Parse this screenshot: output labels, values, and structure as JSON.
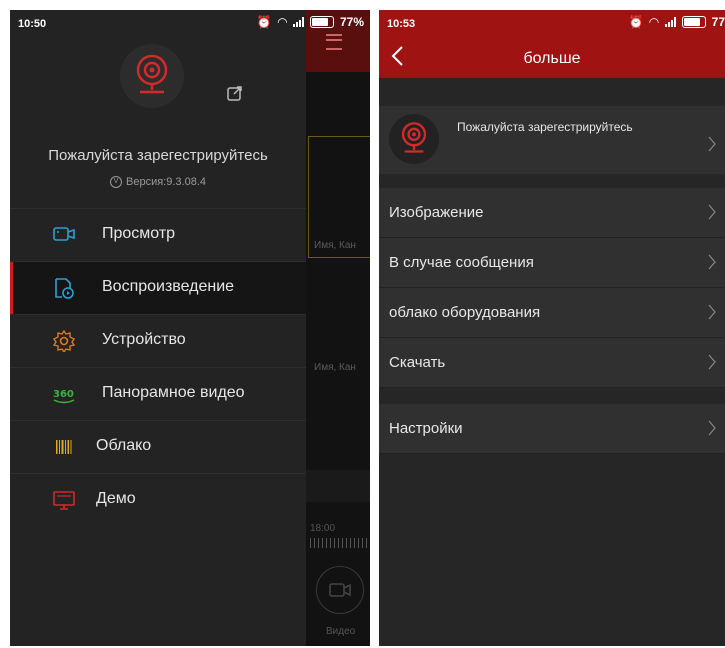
{
  "left_screen": {
    "status": {
      "time": "10:50",
      "battery": "77%"
    },
    "prompt": "Пожалуйста зарегестрируйтесь",
    "version": "Версия:9.3.08.4",
    "menu": [
      {
        "label": "Просмотр",
        "icon": "camera-icon",
        "active": false
      },
      {
        "label": "Воспроизведение",
        "icon": "playback-icon",
        "active": true
      },
      {
        "label": "Устройство",
        "icon": "gear-icon",
        "active": false
      },
      {
        "label": "Панорамное видео",
        "icon": "panorama-360-icon",
        "active": false
      },
      {
        "label": "Облако",
        "icon": "cloud-icon",
        "active": false
      },
      {
        "label": "Демо",
        "icon": "demo-monitor-icon",
        "active": false
      }
    ],
    "behind_labels": {
      "name1": "Имя, Кан",
      "name2": "Имя, Кан",
      "time": "18:00",
      "video": "Видео"
    }
  },
  "right_screen": {
    "status": {
      "time": "10:53",
      "battery": "77"
    },
    "title": "больше",
    "prompt": "Пожалуйста зарегестрируйтесь",
    "rows": [
      {
        "label": "Изображение"
      },
      {
        "label": "В случае сообщения"
      },
      {
        "label": "облако оборудования"
      },
      {
        "label": "Скачать"
      },
      {
        "label": "Настройки"
      }
    ]
  },
  "colors": {
    "accent": "#a01313",
    "icon_red": "#d42a2a",
    "active_bar": "#cc1b1b",
    "dark_bg": "#232323"
  }
}
